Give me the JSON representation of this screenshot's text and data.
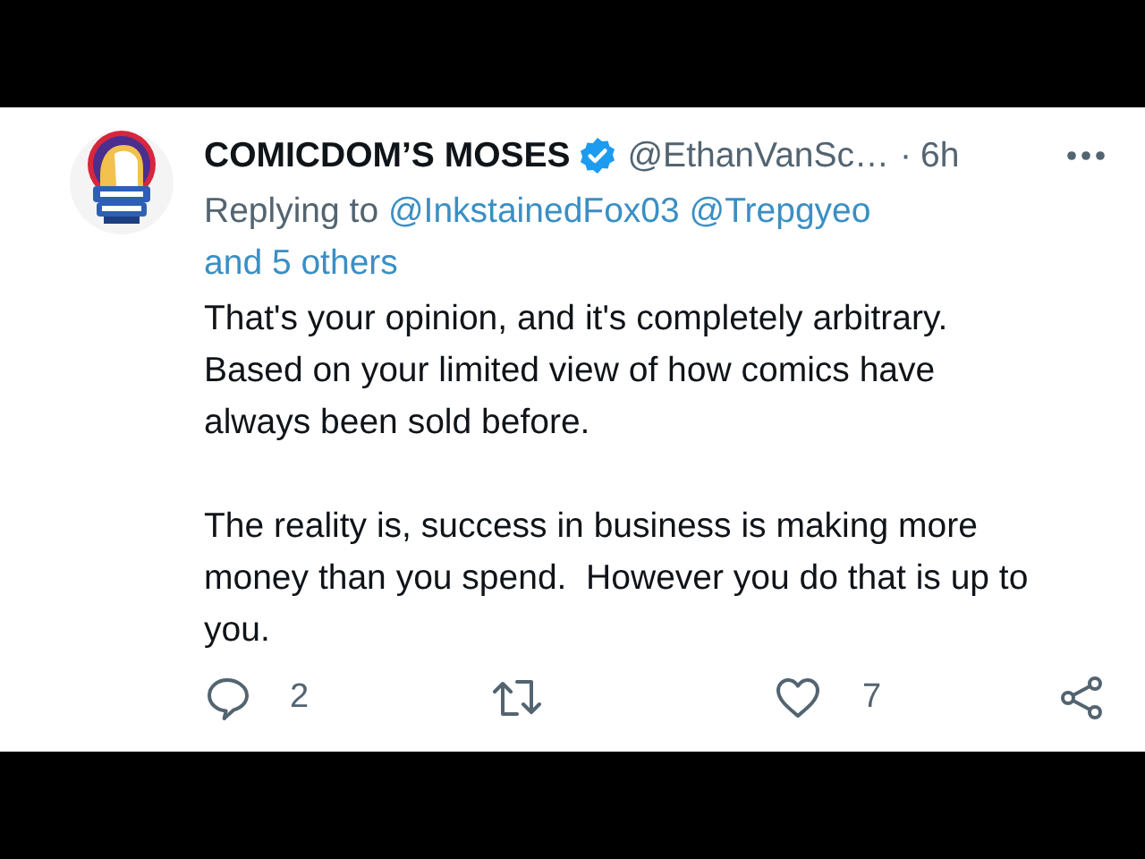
{
  "tweet": {
    "display_name": "COMICDOM’S MOSES",
    "verified": true,
    "handle": "@EthanVanSc…",
    "separator": "·",
    "time": "6h",
    "reply_context": {
      "prefix": "Replying to",
      "mentions": [
        "@InkstainedFox03",
        "@Trepgyeo"
      ],
      "others": "and 5 others"
    },
    "paragraphs": [
      "That's your opinion, and it's completely arbitrary. Based on your limited view of how comics have always been sold before.",
      "The reality is, success in business is making more money than you spend.  However you do that is up to you."
    ],
    "actions": [
      {
        "kind": "reply",
        "count": "2"
      },
      {
        "kind": "retweet"
      },
      {
        "kind": "like",
        "count": "7"
      },
      {
        "kind": "share"
      }
    ]
  }
}
